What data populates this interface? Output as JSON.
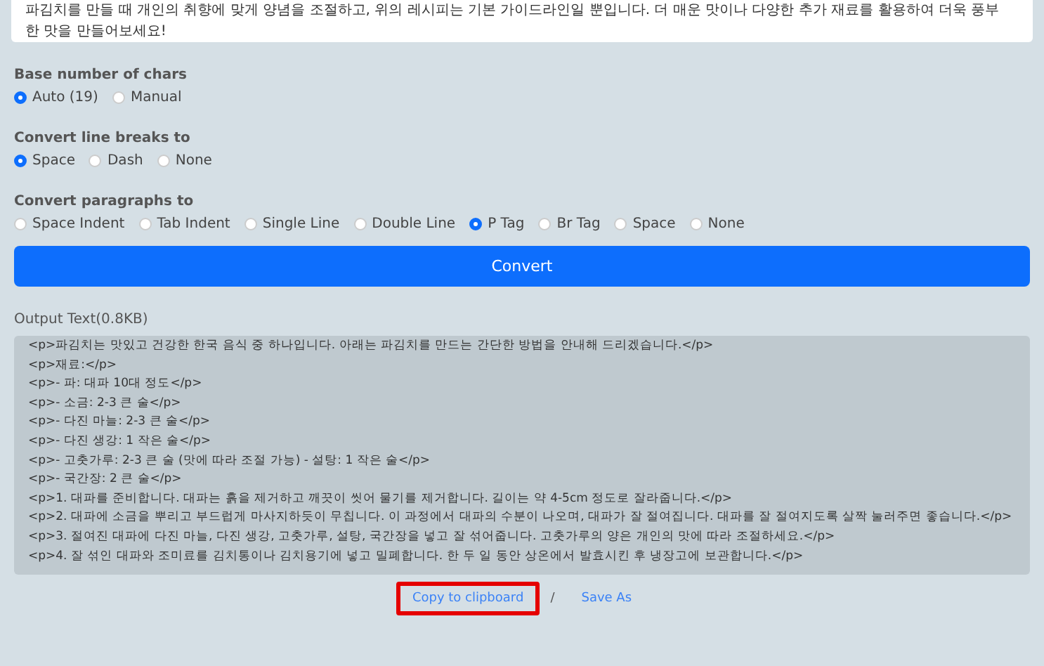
{
  "input_text": "파김치를 만들 때 개인의 취향에 맞게 양념을 조절하고, 위의 레시피는 기본 가이드라인일 뿐입니다. 더 매운 맛이나 다양한 추가 재료를 활용하여 더욱 풍부한 맛을 만들어보세요!",
  "option_groups": [
    {
      "label": "Base number of chars",
      "options": [
        {
          "label": "Auto (19)",
          "selected": true
        },
        {
          "label": "Manual",
          "selected": false
        }
      ]
    },
    {
      "label": "Convert line breaks to",
      "options": [
        {
          "label": "Space",
          "selected": true
        },
        {
          "label": "Dash",
          "selected": false
        },
        {
          "label": "None",
          "selected": false
        }
      ]
    },
    {
      "label": "Convert paragraphs to",
      "options": [
        {
          "label": "Space Indent",
          "selected": false
        },
        {
          "label": "Tab Indent",
          "selected": false
        },
        {
          "label": "Single Line",
          "selected": false
        },
        {
          "label": "Double Line",
          "selected": false
        },
        {
          "label": "P Tag",
          "selected": true
        },
        {
          "label": "Br Tag",
          "selected": false
        },
        {
          "label": "Space",
          "selected": false
        },
        {
          "label": "None",
          "selected": false
        }
      ]
    }
  ],
  "convert_button": "Convert",
  "output_label": "Output Text(0.8KB)",
  "output_lines": [
    "<p>파김치는 맛있고 건강한 한국 음식 중 하나입니다. 아래는 파김치를 만드는 간단한 방법을 안내해 드리겠습니다.</p>",
    "<p>재료:</p>",
    "<p>- 파: 대파 10대 정도</p>",
    "<p>- 소금: 2-3 큰 술</p>",
    "<p>- 다진 마늘: 2-3 큰 술</p>",
    "<p>- 다진 생강: 1 작은 술</p>",
    "<p>- 고춧가루: 2-3 큰 술 (맛에 따라 조절 가능) - 설탕: 1 작은 술</p>",
    "<p>- 국간장: 2 큰 술</p>",
    "<p>1. 대파를 준비합니다. 대파는 흙을 제거하고 깨끗이 씻어 물기를 제거합니다. 길이는 약 4-5cm 정도로 잘라줍니다.</p>",
    "<p>2. 대파에 소금을 뿌리고 부드럽게 마사지하듯이 무칩니다. 이 과정에서 대파의 수분이 나오며, 대파가 잘 절여집니다. 대파를 잘 절여지도록 살짝 눌러주면 좋습니다.</p>",
    "<p>3. 절여진 대파에 다진 마늘, 다진 생강, 고춧가루, 설탕, 국간장을 넣고 잘 섞어줍니다. 고춧가루의 양은 개인의 맛에 따라 조절하세요.</p>",
    "<p>4. 잘 섞인 대파와 조미료를 김치통이나 김치용기에 넣고 밀폐합니다. 한 두 일 동안 상온에서 발효시킨 후 냉장고에 보관합니다.</p>"
  ],
  "actions": [
    {
      "label": "Copy to clipboard",
      "highlighted": true
    },
    {
      "label": "Save As",
      "highlighted": false
    }
  ],
  "separator": "/"
}
